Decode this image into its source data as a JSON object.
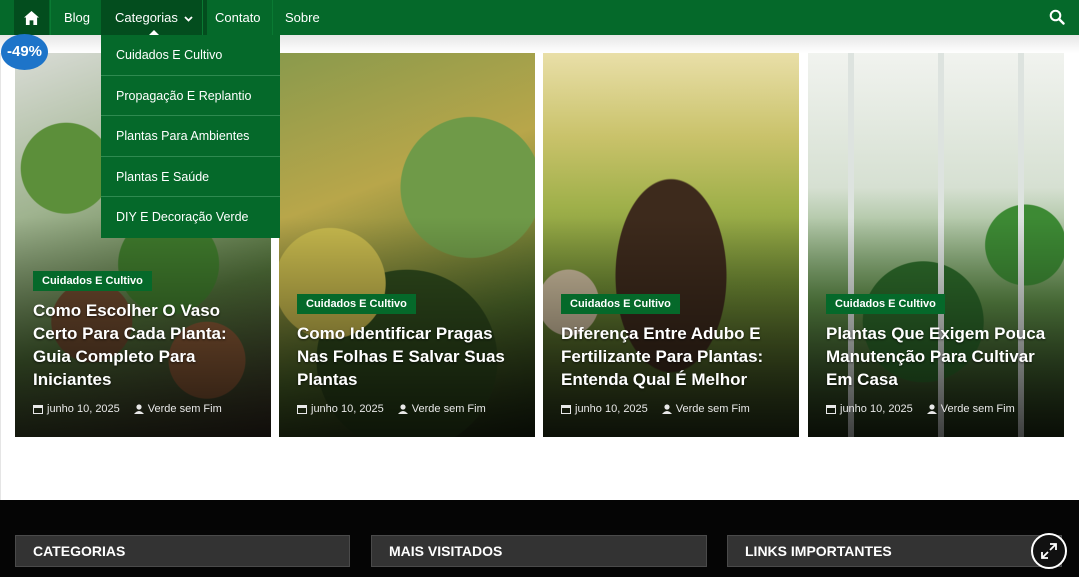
{
  "nav": {
    "home_icon": "home-icon",
    "items": [
      {
        "label": "Blog"
      },
      {
        "label": "Categorias"
      },
      {
        "label": "Contato"
      },
      {
        "label": "Sobre"
      }
    ],
    "search_icon": "search-icon",
    "accent": "#05692a",
    "accent_dark": "#034d1e"
  },
  "dropdown": {
    "items": [
      {
        "label": "Cuidados E Cultivo"
      },
      {
        "label": "Propagação E Replantio"
      },
      {
        "label": "Plantas Para Ambientes"
      },
      {
        "label": "Plantas E Saúde"
      },
      {
        "label": "DIY E Decoração Verde"
      }
    ]
  },
  "discount_badge": "-49%",
  "posts": [
    {
      "category": "Cuidados E Cultivo",
      "title": "Como Escolher O Vaso Certo Para Cada Planta: Guia Completo Para Iniciantes",
      "date": "junho 10, 2025",
      "author": "Verde sem Fim"
    },
    {
      "category": "Cuidados E Cultivo",
      "title": "Como Identificar Pragas Nas Folhas E Salvar Suas Plantas",
      "date": "junho 10, 2025",
      "author": "Verde sem Fim"
    },
    {
      "category": "Cuidados E Cultivo",
      "title": "Diferença Entre Adubo E Fertilizante Para Plantas: Entenda Qual É Melhor",
      "date": "junho 10, 2025",
      "author": "Verde sem Fim"
    },
    {
      "category": "Cuidados E Cultivo",
      "title": "Plantas Que Exigem Pouca Manutenção Para Cultivar Em Casa",
      "date": "junho 10, 2025",
      "author": "Verde sem Fim"
    }
  ],
  "footer": {
    "sections": [
      {
        "title": "CATEGORIAS"
      },
      {
        "title": "MAIS VISITADOS"
      },
      {
        "title": "LINKS IMPORTANTES"
      }
    ],
    "expand_icon": "expand-icon"
  }
}
